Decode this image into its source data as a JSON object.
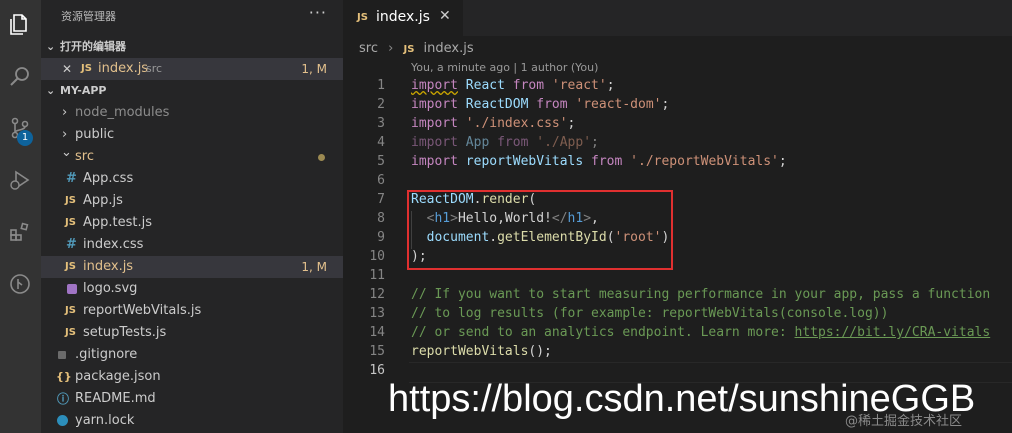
{
  "explorer": {
    "title": "资源管理器",
    "more": "···",
    "open_editors": {
      "header": "打开的编辑器",
      "items": [
        {
          "close": "✕",
          "icon": "JS",
          "name": "index.js",
          "path": "src",
          "status": "1, M"
        }
      ]
    },
    "project": {
      "header": "MY-APP",
      "items": [
        {
          "icon": "›",
          "name": "node_modules"
        },
        {
          "icon": "›",
          "name": "public"
        },
        {
          "icon": "⌄",
          "name": "src"
        },
        {
          "icon": "#",
          "name": "App.css"
        },
        {
          "icon": "JS",
          "name": "App.js"
        },
        {
          "icon": "JS",
          "name": "App.test.js"
        },
        {
          "icon": "#",
          "name": "index.css"
        },
        {
          "icon": "JS",
          "name": "index.js",
          "status": "1, M"
        },
        {
          "icon": "",
          "name": "logo.svg"
        },
        {
          "icon": "JS",
          "name": "reportWebVitals.js"
        },
        {
          "icon": "JS",
          "name": "setupTests.js"
        },
        {
          "icon": "",
          "name": ".gitignore"
        },
        {
          "icon": "{}",
          "name": "package.json"
        },
        {
          "icon": "ⓘ",
          "name": "README.md"
        },
        {
          "icon": "",
          "name": "yarn.lock"
        }
      ]
    }
  },
  "activity": {
    "scm_badge": "1"
  },
  "editor": {
    "tab": {
      "icon": "JS",
      "name": "index.js",
      "close": "✕"
    },
    "breadcrumb": {
      "folder": "src",
      "sep": "›",
      "icon": "JS",
      "file": "index.js"
    },
    "blame": "You, a minute ago | 1 author (You)",
    "line_numbers": [
      "1",
      "2",
      "3",
      "4",
      "5",
      "6",
      "7",
      "8",
      "9",
      "10",
      "11",
      "12",
      "13",
      "14",
      "15",
      "16"
    ],
    "lines": {
      "l1": {
        "a": "import",
        "b": " ",
        "c": "React",
        "d": " ",
        "e": "from",
        "f": " ",
        "g": "'react'",
        "h": ";"
      },
      "l2": {
        "a": "import",
        "b": " ",
        "c": "ReactDOM",
        "d": " ",
        "e": "from",
        "f": " ",
        "g": "'react-dom'",
        "h": ";"
      },
      "l3": {
        "a": "import",
        "b": " ",
        "g": "'./index.css'",
        "h": ";"
      },
      "l4": {
        "a": "import",
        "b": " ",
        "c": "App",
        "d": " ",
        "e": "from",
        "f": " ",
        "g": "'./App'",
        "h": ";"
      },
      "l5": {
        "a": "import",
        "b": " ",
        "c": "reportWebVitals",
        "d": " ",
        "e": "from",
        "f": " ",
        "g": "'./reportWebVitals'",
        "h": ";"
      },
      "l7": {
        "a": "ReactDOM",
        "b": ".",
        "c": "render",
        "d": "("
      },
      "l8": {
        "i": "  ",
        "a": "<",
        "b": "h1",
        "c": ">",
        "d": "Hello,World!",
        "e": "</",
        "f": "h1",
        "g": ">",
        "h": ","
      },
      "l9": {
        "i": "  ",
        "a": "document",
        "b": ".",
        "c": "getElementById",
        "d": "(",
        "e": "'root'",
        "f": ")"
      },
      "l10": {
        "a": ");"
      },
      "l12": "// If you want to start measuring performance in your app, pass a function",
      "l13": "// to log results (for example: reportWebVitals(console.log))",
      "l14": {
        "a": "// or send to an analytics endpoint. Learn more: ",
        "b": "https://bit.ly/CRA-vitals"
      },
      "l15": {
        "a": "reportWebVitals",
        "b": "();"
      }
    }
  },
  "watermark": "https://blog.csdn.net/sunshineGGB",
  "watermark2": "@稀土掘金技术社区"
}
